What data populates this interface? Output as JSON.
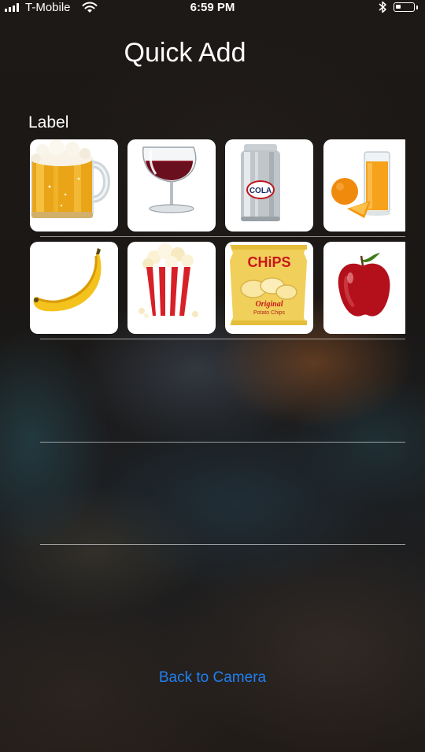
{
  "status_bar": {
    "carrier": "T-Mobile",
    "time": "6:59 PM",
    "battery_level": 0.3
  },
  "header": {
    "title": "Quick Add"
  },
  "section": {
    "label": "Label"
  },
  "items": [
    {
      "name": "beer",
      "icon": "beer-mug-icon"
    },
    {
      "name": "wine",
      "icon": "wine-glass-icon"
    },
    {
      "name": "cola",
      "icon": "cola-can-icon",
      "label": "COLA"
    },
    {
      "name": "orange juice",
      "icon": "orange-juice-icon"
    },
    {
      "name": "banana",
      "icon": "banana-icon"
    },
    {
      "name": "popcorn",
      "icon": "popcorn-icon"
    },
    {
      "name": "chips",
      "icon": "chips-bag-icon",
      "label": "CHiPS",
      "sub": "Original",
      "sub2": "Potato Chips"
    },
    {
      "name": "apple",
      "icon": "apple-icon"
    }
  ],
  "footer": {
    "back_label": "Back to Camera"
  },
  "colors": {
    "link": "#1f7ff2",
    "tile": "#ffffff",
    "text": "#ffffff"
  }
}
